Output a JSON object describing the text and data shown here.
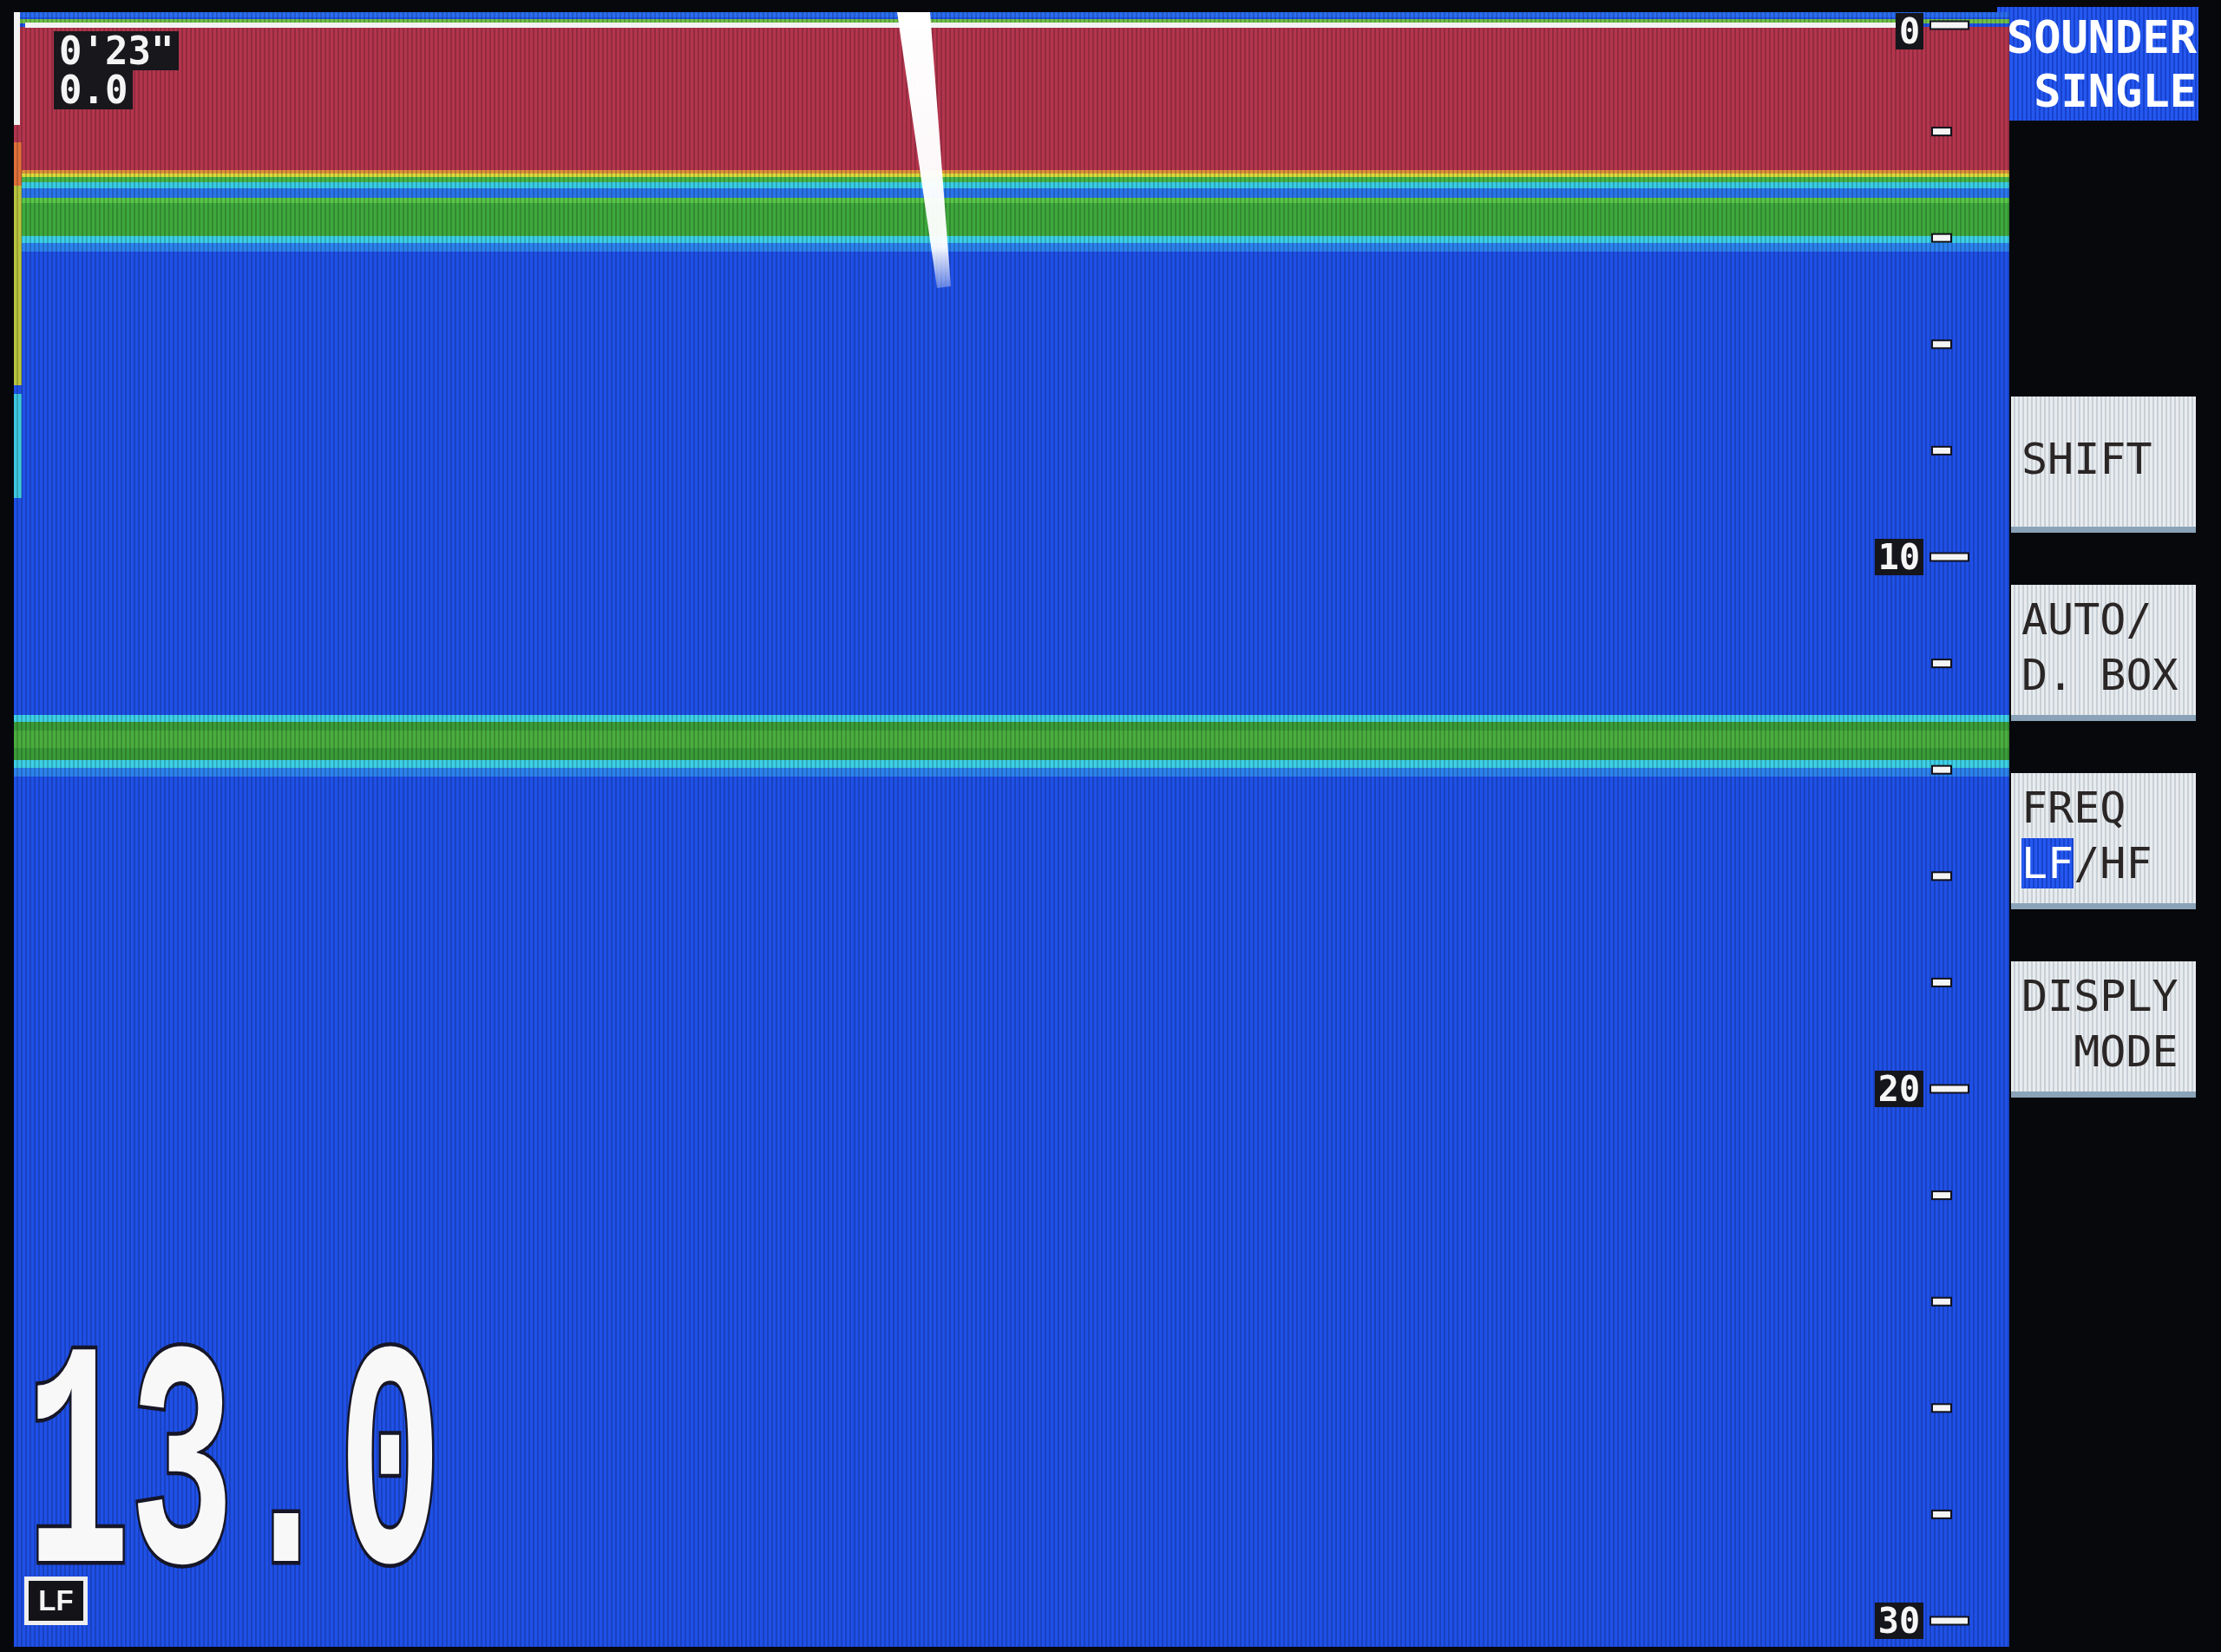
{
  "echogram": {
    "readouts": [
      "0'23\"",
      "0.0"
    ],
    "depth_scale": [
      "0",
      "10",
      "20",
      "30"
    ],
    "depth": "13.0",
    "frequency": "LF"
  },
  "mode": [
    "SOUNDER",
    "SINGLE"
  ],
  "soft_keys": [
    {
      "kind": "label",
      "lines": [
        "SHIFT"
      ]
    },
    {
      "kind": "label",
      "lines": [
        "AUTO/",
        "D. BOX"
      ]
    },
    {
      "kind": "toggle",
      "title": "FREQ",
      "separator": "/",
      "options": [
        {
          "label": "LF",
          "selected": true
        },
        {
          "label": "HF",
          "selected": false
        }
      ]
    },
    {
      "kind": "label",
      "lines": [
        "DISPLY",
        "MODE"
      ]
    }
  ]
}
